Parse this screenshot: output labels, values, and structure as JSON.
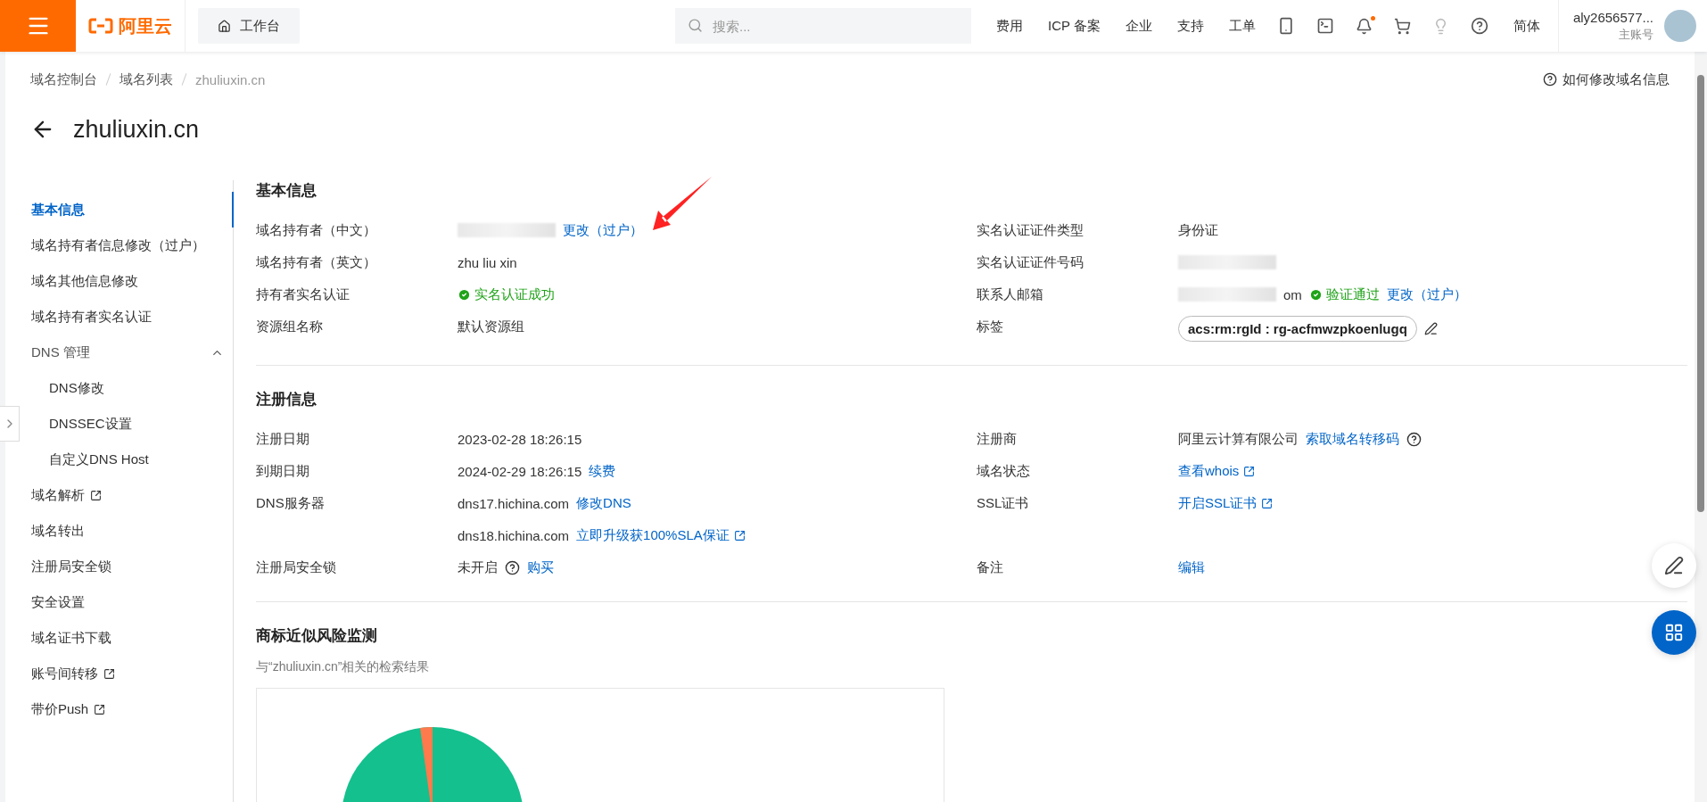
{
  "header": {
    "brand": "阿里云",
    "workbench": "工作台",
    "search": {
      "placeholder": "搜索..."
    },
    "nav": [
      "费用",
      "ICP 备案",
      "企业",
      "支持",
      "工单"
    ],
    "language": "简体",
    "account": {
      "name": "aly2656577...",
      "role": "主账号"
    }
  },
  "breadcrumb": [
    "域名控制台",
    "域名列表",
    "zhuliuxin.cn"
  ],
  "help_link": "如何修改域名信息",
  "title": "zhuliuxin.cn",
  "sidebar": {
    "items": [
      {
        "label": "基本信息",
        "selected": true,
        "external": false
      },
      {
        "label": "域名持有者信息修改（过户）",
        "selected": false,
        "external": false
      },
      {
        "label": "域名其他信息修改",
        "selected": false,
        "external": false
      },
      {
        "label": "域名持有者实名认证",
        "selected": false,
        "external": false
      },
      {
        "label": "DNS 管理",
        "selected": false,
        "external": false,
        "expanded": true,
        "children": [
          {
            "label": "DNS修改",
            "selected": false,
            "external": false
          },
          {
            "label": "DNSSEC设置",
            "selected": false,
            "external": false
          },
          {
            "label": "自定义DNS Host",
            "selected": false,
            "external": false
          }
        ]
      },
      {
        "label": "域名解析",
        "selected": false,
        "external": true
      },
      {
        "label": "域名转出",
        "selected": false,
        "external": false
      },
      {
        "label": "注册局安全锁",
        "selected": false,
        "external": false
      },
      {
        "label": "安全设置",
        "selected": false,
        "external": false
      },
      {
        "label": "域名证书下载",
        "selected": false,
        "external": false
      },
      {
        "label": "账号间转移",
        "selected": false,
        "external": true
      },
      {
        "label": "带价Push",
        "selected": false,
        "external": true
      }
    ]
  },
  "sections": [
    {
      "title": "基本信息",
      "rows": [
        [
          {
            "label": "域名持有者（中文）",
            "lines": [
              [
                {
                  "kind": "redacted"
                },
                {
                  "kind": "link",
                  "text": "更改（过户）",
                  "external": false
                }
              ]
            ]
          },
          {
            "label": "实名认证证件类型",
            "lines": [
              [
                {
                  "kind": "text",
                  "text": "身份证"
                }
              ]
            ]
          }
        ],
        [
          {
            "label": "域名持有者（英文）",
            "lines": [
              [
                {
                  "kind": "text",
                  "text": "zhu liu xin"
                }
              ]
            ]
          },
          {
            "label": "实名认证证件号码",
            "lines": [
              [
                {
                  "kind": "redacted"
                }
              ]
            ]
          }
        ],
        [
          {
            "label": "持有者实名认证",
            "lines": [
              [
                {
                  "kind": "status",
                  "text": "实名认证成功"
                }
              ]
            ]
          },
          {
            "label": "联系人邮箱",
            "lines": [
              [
                {
                  "kind": "redacted"
                },
                {
                  "kind": "text",
                  "text": "om"
                },
                {
                  "kind": "status",
                  "text": "验证通过"
                },
                {
                  "kind": "link",
                  "text": "更改（过户）",
                  "external": false
                }
              ]
            ]
          }
        ],
        [
          {
            "label": "资源组名称",
            "lines": [
              [
                {
                  "kind": "text",
                  "text": "默认资源组"
                }
              ]
            ]
          },
          {
            "label": "标签",
            "lines": [
              [
                {
                  "kind": "tag",
                  "text": "acs:rm:rgId : rg-acfmwzpkoenlugq"
                },
                {
                  "kind": "edit"
                }
              ]
            ]
          }
        ]
      ]
    },
    {
      "title": "注册信息",
      "rows": [
        [
          {
            "label": "注册日期",
            "lines": [
              [
                {
                  "kind": "text",
                  "text": "2023-02-28 18:26:15"
                }
              ]
            ]
          },
          {
            "label": "注册商",
            "lines": [
              [
                {
                  "kind": "text",
                  "text": "阿里云计算有限公司"
                },
                {
                  "kind": "link",
                  "text": "索取域名转移码",
                  "external": false
                },
                {
                  "kind": "help"
                }
              ]
            ]
          }
        ],
        [
          {
            "label": "到期日期",
            "lines": [
              [
                {
                  "kind": "text",
                  "text": "2024-02-29 18:26:15"
                },
                {
                  "kind": "link",
                  "text": "续费",
                  "external": false
                }
              ]
            ]
          },
          {
            "label": "域名状态",
            "lines": [
              [
                {
                  "kind": "link",
                  "text": "查看whois",
                  "external": true
                }
              ]
            ]
          }
        ],
        [
          {
            "label": "DNS服务器",
            "lines": [
              [
                {
                  "kind": "text",
                  "text": "dns17.hichina.com"
                },
                {
                  "kind": "link",
                  "text": "修改DNS",
                  "external": false
                }
              ],
              [
                {
                  "kind": "text",
                  "text": "dns18.hichina.com"
                },
                {
                  "kind": "link",
                  "text": "立即升级获100%SLA保证",
                  "external": true
                }
              ]
            ]
          },
          {
            "label": "SSL证书",
            "lines": [
              [
                {
                  "kind": "link",
                  "text": "开启SSL证书",
                  "external": true
                }
              ]
            ]
          }
        ],
        [
          {
            "label": "注册局安全锁",
            "lines": [
              [
                {
                  "kind": "text",
                  "text": "未开启"
                },
                {
                  "kind": "help"
                },
                {
                  "kind": "link",
                  "text": "购买",
                  "external": false
                }
              ]
            ]
          },
          {
            "label": "备注",
            "lines": [
              [
                {
                  "kind": "link",
                  "text": "编辑",
                  "external": false
                }
              ]
            ]
          }
        ]
      ]
    }
  ],
  "monitor": {
    "title": "商标近似风险监测",
    "subtitle": "与“zhuliuxin.cn”相关的检索结果"
  }
}
